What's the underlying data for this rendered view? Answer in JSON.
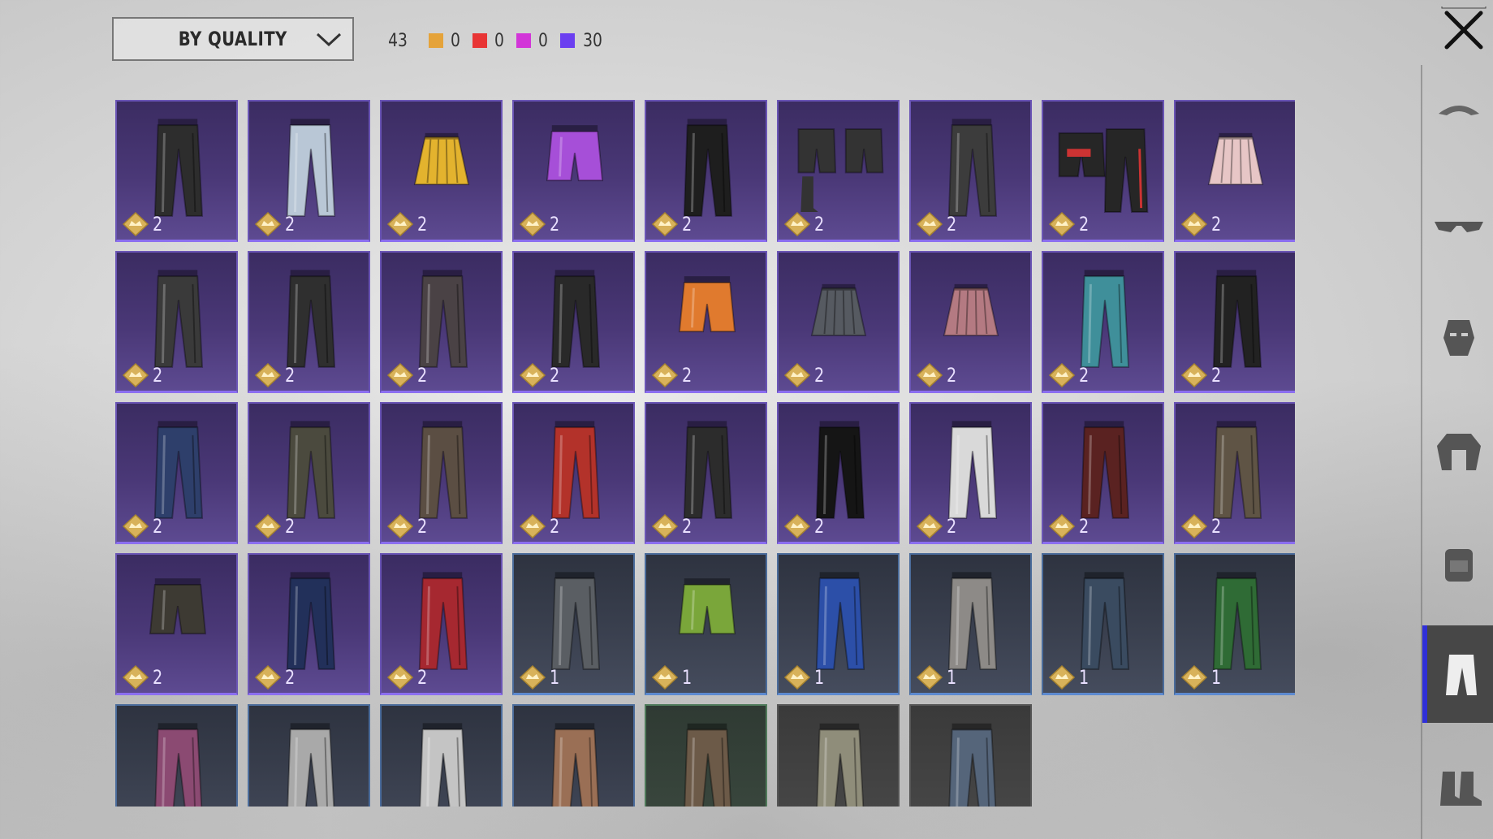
{
  "filter": {
    "sort_label": "BY QUALITY",
    "icon": "chevron-down-icon"
  },
  "summary": {
    "total": "43",
    "qualities": [
      {
        "name": "legendary",
        "color": "#e5a33a",
        "count": "0"
      },
      {
        "name": "epic-red",
        "color": "#e83535",
        "count": "0"
      },
      {
        "name": "magenta",
        "color": "#d235d8",
        "count": "0"
      },
      {
        "name": "purple",
        "color": "#6b3ff0",
        "count": "30"
      }
    ]
  },
  "items": [
    {
      "name": "black-leather-pants",
      "tier": "purple",
      "level": "2",
      "color": "#2d2d2d"
    },
    {
      "name": "light-blue-jeans",
      "tier": "purple",
      "level": "2",
      "color": "#b9c7d6"
    },
    {
      "name": "yellow-pleated-skirt",
      "tier": "purple",
      "level": "2",
      "color": "#e3b32e"
    },
    {
      "name": "purple-shorts",
      "tier": "purple",
      "level": "2",
      "color": "#a64fd8"
    },
    {
      "name": "black-red-tactical-pants",
      "tier": "purple",
      "level": "2",
      "color": "#1e1e1e"
    },
    {
      "name": "shorts-with-boots",
      "tier": "purple",
      "level": "2",
      "color": "#333333"
    },
    {
      "name": "grey-joggers",
      "tier": "purple",
      "level": "2",
      "color": "#3c3c3c"
    },
    {
      "name": "black-shorts-red-pants",
      "tier": "purple",
      "level": "2",
      "color": "#262626"
    },
    {
      "name": "floral-skirt",
      "tier": "purple",
      "level": "2",
      "color": "#e7c6c6"
    },
    {
      "name": "camo-patched-pants",
      "tier": "purple",
      "level": "2",
      "color": "#3a3a3a"
    },
    {
      "name": "black-strap-pants",
      "tier": "purple",
      "level": "2",
      "color": "#2f2f2f"
    },
    {
      "name": "dark-pink-striped-pants",
      "tier": "purple",
      "level": "2",
      "color": "#4a4245"
    },
    {
      "name": "black-cargo-pants",
      "tier": "purple",
      "level": "2",
      "color": "#292929"
    },
    {
      "name": "orange-hot-pants",
      "tier": "purple",
      "level": "2",
      "color": "#e07a2e"
    },
    {
      "name": "grey-mini-skirt",
      "tier": "purple",
      "level": "2",
      "color": "#565a61"
    },
    {
      "name": "plaid-skirt",
      "tier": "purple",
      "level": "2",
      "color": "#b47a82"
    },
    {
      "name": "teal-jeans",
      "tier": "purple",
      "level": "2",
      "color": "#3f8f9a"
    },
    {
      "name": "black-leather-trousers",
      "tier": "purple",
      "level": "2",
      "color": "#222222"
    },
    {
      "name": "navy-jeans",
      "tier": "purple",
      "level": "2",
      "color": "#2e3f6b"
    },
    {
      "name": "olive-jeans",
      "tier": "purple",
      "level": "2",
      "color": "#4b4a3e"
    },
    {
      "name": "brown-leather-pants",
      "tier": "purple",
      "level": "2",
      "color": "#5b4e43"
    },
    {
      "name": "red-pants",
      "tier": "purple",
      "level": "2",
      "color": "#b3322a"
    },
    {
      "name": "biker-pants",
      "tier": "purple",
      "level": "2",
      "color": "#2c2c2c"
    },
    {
      "name": "black-flared-pants",
      "tier": "purple",
      "level": "2",
      "color": "#151515"
    },
    {
      "name": "white-pants",
      "tier": "purple",
      "level": "2",
      "color": "#d9d9d9"
    },
    {
      "name": "maroon-pants",
      "tier": "purple",
      "level": "2",
      "color": "#5a2221"
    },
    {
      "name": "khaki-cargo-pants",
      "tier": "purple",
      "level": "2",
      "color": "#5f5445"
    },
    {
      "name": "camo-shorts",
      "tier": "purple",
      "level": "2",
      "color": "#3d3a33"
    },
    {
      "name": "dark-navy-jeans",
      "tier": "purple",
      "level": "2",
      "color": "#22305a"
    },
    {
      "name": "red-black-track-pants",
      "tier": "purple",
      "level": "2",
      "color": "#a62830"
    },
    {
      "name": "grey-track-pants",
      "tier": "blue",
      "level": "1",
      "color": "#5a5e63"
    },
    {
      "name": "green-shorts",
      "tier": "blue",
      "level": "1",
      "color": "#7aa63a"
    },
    {
      "name": "blue-track-pants",
      "tier": "blue",
      "level": "1",
      "color": "#2c4fa8"
    },
    {
      "name": "grey-cargo-pants",
      "tier": "blue",
      "level": "1",
      "color": "#8d8a87"
    },
    {
      "name": "washed-jeans",
      "tier": "blue",
      "level": "1",
      "color": "#3a4b60"
    },
    {
      "name": "green-pants",
      "tier": "blue",
      "level": "1",
      "color": "#2f6b35"
    },
    {
      "name": "pink-jeans",
      "tier": "blue",
      "level": "",
      "color": "#8b4a72"
    },
    {
      "name": "white-camo-pants",
      "tier": "blue",
      "level": "",
      "color": "#a9a9a9"
    },
    {
      "name": "grey-camo-pants",
      "tier": "blue",
      "level": "",
      "color": "#c4c4c4"
    },
    {
      "name": "tan-cargo-pants",
      "tier": "blue",
      "level": "",
      "color": "#9a6f55"
    },
    {
      "name": "brown-work-pants",
      "tier": "green",
      "level": "",
      "color": "#6c5a48"
    },
    {
      "name": "light-khaki-pants",
      "tier": "grey",
      "level": "",
      "color": "#8f8d7a"
    },
    {
      "name": "denim-pants",
      "tier": "grey",
      "level": "",
      "color": "#55657a"
    }
  ],
  "sidebar": [
    {
      "name": "hat",
      "icon": "hat-icon",
      "active": false
    },
    {
      "name": "glasses",
      "icon": "sunglasses-icon",
      "active": false
    },
    {
      "name": "mask",
      "icon": "mask-icon",
      "active": false
    },
    {
      "name": "jacket",
      "icon": "jacket-icon",
      "active": false
    },
    {
      "name": "backpack",
      "icon": "backpack-icon",
      "active": false
    },
    {
      "name": "pants",
      "icon": "pants-icon",
      "active": true
    },
    {
      "name": "shoes",
      "icon": "boots-icon",
      "active": false
    }
  ],
  "close": {
    "icon": "close-icon"
  }
}
